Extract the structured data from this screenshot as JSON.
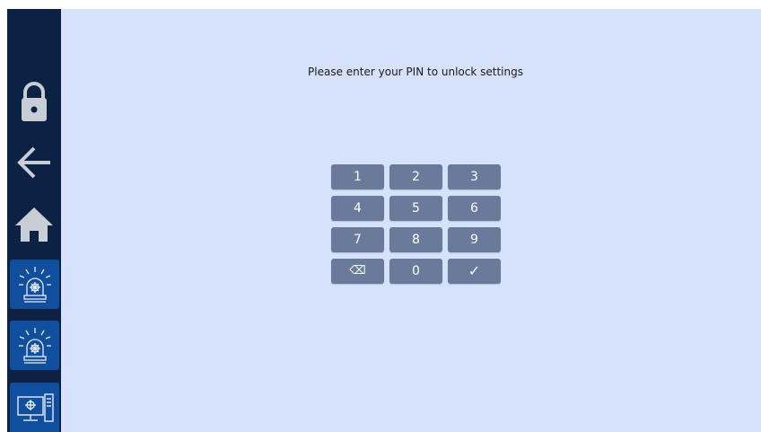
{
  "prompt": {
    "text": "Please enter your PIN to unlock settings"
  },
  "sidebar": {
    "items": [
      {
        "icon": "lock-icon"
      },
      {
        "icon": "arrow-left-icon"
      },
      {
        "icon": "home-icon"
      },
      {
        "icon": "siren-icon"
      },
      {
        "icon": "siren-icon"
      },
      {
        "icon": "computer-icon"
      }
    ]
  },
  "keypad": {
    "keys": [
      "1",
      "2",
      "3",
      "4",
      "5",
      "6",
      "7",
      "8",
      "9",
      "⌫",
      "0",
      "✓"
    ]
  },
  "colors": {
    "background": "#d6e2fb",
    "sidebar": "#0c2245",
    "sidebar_button": "#0f4f9e",
    "key": "#6b7a9b",
    "icon": "#c8cdd6"
  }
}
